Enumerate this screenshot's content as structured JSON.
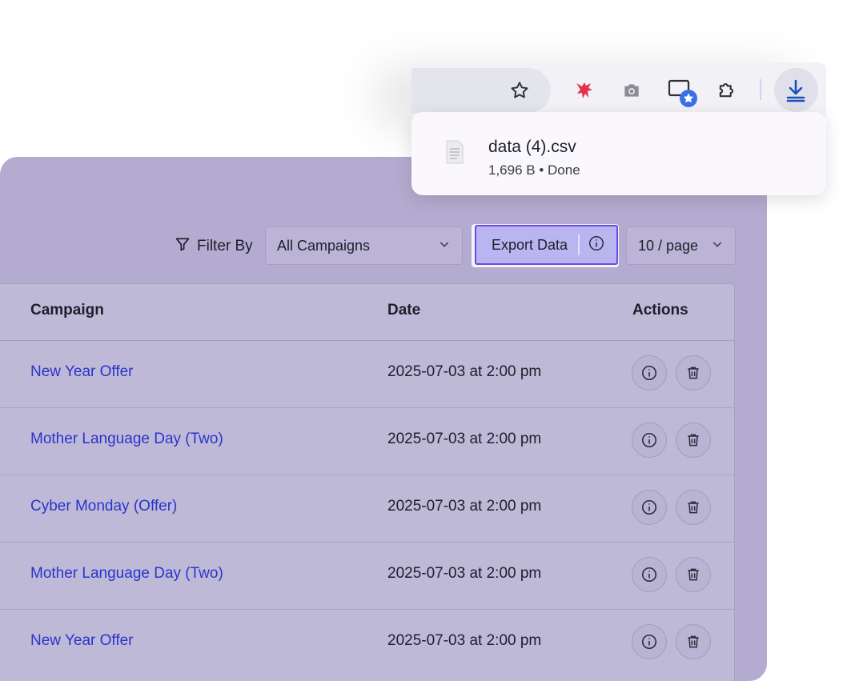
{
  "toolbar": {
    "filter_label": "Filter By",
    "campaign_select": "All Campaigns",
    "export_label": "Export Data",
    "page_size": "10 / page"
  },
  "table": {
    "headers": {
      "campaign": "Campaign",
      "date": "Date",
      "actions": "Actions"
    },
    "rows": [
      {
        "campaign": "New Year Offer",
        "date": "2025-07-03 at 2:00 pm"
      },
      {
        "campaign": "Mother Language Day (Two)",
        "date": "2025-07-03 at 2:00 pm"
      },
      {
        "campaign": "Cyber Monday (Offer)",
        "date": "2025-07-03 at 2:00 pm"
      },
      {
        "campaign": "Mother Language Day (Two)",
        "date": "2025-07-03 at 2:00 pm"
      },
      {
        "campaign": "New Year Offer",
        "date": "2025-07-03 at 2:00 pm"
      }
    ]
  },
  "download": {
    "file_name": "data (4).csv",
    "file_meta": "1,696 B • Done"
  },
  "icons": {
    "toolbar": [
      "star-icon",
      "extension-bird-icon",
      "camera-icon",
      "cast-star-icon",
      "puzzle-icon",
      "download-icon"
    ],
    "row_actions": [
      "info-icon",
      "trash-icon"
    ]
  },
  "colors": {
    "accent": "#6a4be6",
    "link": "#2a35c9",
    "panel": "#b4acd0",
    "download": "#1d4fb8"
  }
}
